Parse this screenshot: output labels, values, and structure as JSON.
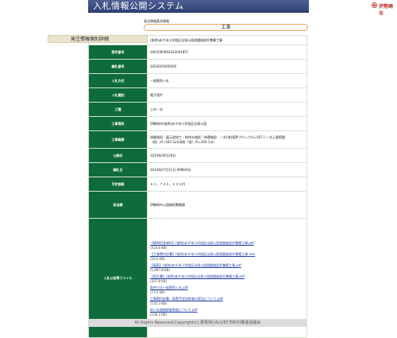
{
  "header": {
    "title": "入札情報公開システム",
    "city": "伊勢崎市"
  },
  "section": {
    "subtitle": "発注情報基本情報",
    "title": "工事"
  },
  "detail_bar": "発注情報個別詳細",
  "rows": [
    {
      "label": "件名",
      "value": "(仮称)赤ず米小学校区出張公園遊戯施設外整備工事"
    },
    {
      "label": "案件番号",
      "value": "5061090062024001857"
    },
    {
      "label": "開札番号",
      "value": "2024020400020"
    },
    {
      "label": "入札方式",
      "value": "一般競争入札"
    },
    {
      "label": "入札種別",
      "value": "電子案件"
    },
    {
      "label": "工種",
      "value": "土木一式"
    },
    {
      "label": "工事場所",
      "value": "伊勢崎市(仮称)赤ず米小学校区出張公園"
    },
    {
      "label": "工事概要",
      "value": "遊戯施設・展示造成工・他排水施設・休憩施設　一式(他)境界ブロック(L=407.) 一式上屋続盤（他）/A=583.3㎡(改修（他）/A=309.1㎡)"
    },
    {
      "label": "公開日",
      "value": "2024年06月28日"
    },
    {
      "label": "開札日",
      "value": "2024年07月12日 09時30分"
    },
    {
      "label": "予定価格",
      "value": "８３，７４０，０００円"
    },
    {
      "label": "担当課",
      "value": "伊勢崎市公園緑地整備課"
    }
  ],
  "files_label": "入札公告等ファイル",
  "files": [
    {
      "name": "【質問回答資料】(仮称)赤ず米小学校区出張公園遊戯施設外整備工事.pdf",
      "size": "(410.6 KB)"
    },
    {
      "name": "【工事費内訳書】(仮称)赤ず米小学校区出張公園遊戯施設外整備工事.xlsx",
      "size": "(16.0 KB)"
    },
    {
      "name": "【図面】(仮称)赤ず米小学校区出張公園遊戯施設外整備工事.pdf",
      "size": "(1,687.8 KB)"
    },
    {
      "name": "【設計書】(仮称)赤ず米小学校区出張公園遊戯施設外整備工事.pdf",
      "size": "(337.8 KB)"
    },
    {
      "name": "条件付き一般競争入札.pdf",
      "size": "(73.5 KB)"
    },
    {
      "name": "工事費内訳書、配置予定技術者の提出について.pdf",
      "size": "(135.3 KB)"
    },
    {
      "name": "低入札価格調査制度について.pdf",
      "size": "(158.2 KB)"
    }
  ],
  "footer": {
    "copyright": "All Rights Reserved,Copyright(c) 群馬県CALS/EC市町村推進協議会"
  },
  "colors": {
    "label_bg": "#0f6b3b",
    "header_bg": "#34467a",
    "link": "#1e3fa8"
  }
}
